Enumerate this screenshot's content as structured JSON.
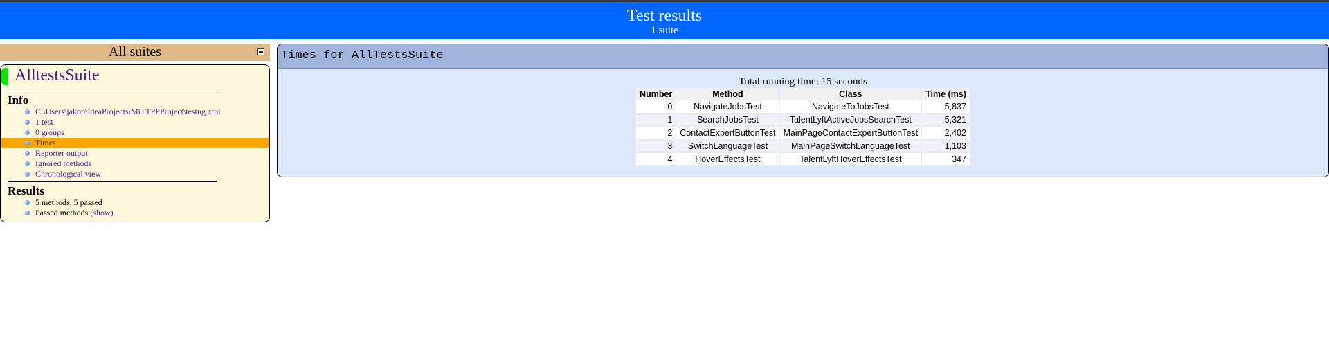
{
  "header": {
    "title": "Test results",
    "subtitle": "1 suite"
  },
  "sidebar": {
    "heading": "All suites",
    "suite_name": "AlltestsSuite",
    "info_title": "Info",
    "info_items": [
      {
        "label": "C:\\Users\\jakop\\IdeaProjects\\MiTTPPProject\\testng.xml"
      },
      {
        "label": "1 test"
      },
      {
        "label": "0 groups"
      },
      {
        "label": "Times",
        "active": true
      },
      {
        "label": "Reporter output"
      },
      {
        "label": "Ignored methods"
      },
      {
        "label": "Chronological view"
      }
    ],
    "results_title": "Results",
    "results_items": {
      "summary": "5 methods, 5 passed",
      "passed_label": "Passed methods",
      "show_link": "(show)"
    }
  },
  "main": {
    "title": "Times for AllTestsSuite",
    "total_running_time": "Total running time: 15 seconds",
    "table": {
      "columns": [
        "Number",
        "Method",
        "Class",
        "Time (ms)"
      ],
      "rows": [
        {
          "number": "0",
          "method": "NavigateJobsTest",
          "class": "NavigateToJobsTest",
          "time": "5,837"
        },
        {
          "number": "1",
          "method": "SearchJobsTest",
          "class": "TalentLyftActiveJobsSearchTest",
          "time": "5,321"
        },
        {
          "number": "2",
          "method": "ContactExpertButtonTest",
          "class": "MainPageContactExpertButtonTest",
          "time": "2,402"
        },
        {
          "number": "3",
          "method": "SwitchLanguageTest",
          "class": "MainPageSwitchLanguageTest",
          "time": "1,103"
        },
        {
          "number": "4",
          "method": "HoverEffectsTest",
          "class": "TalentLyftHoverEffectsTest",
          "time": "347"
        }
      ]
    }
  },
  "colors": {
    "header_bg": "#0066ff",
    "suites_bar_bg": "#deb887",
    "suite_box_bg": "#fff8dc",
    "active_item_bg": "#ffa500",
    "main_bg": "#dde7fa",
    "main_head_bg": "#a0b4dc",
    "suite_status": "#00e600",
    "link": "#551a8b"
  }
}
